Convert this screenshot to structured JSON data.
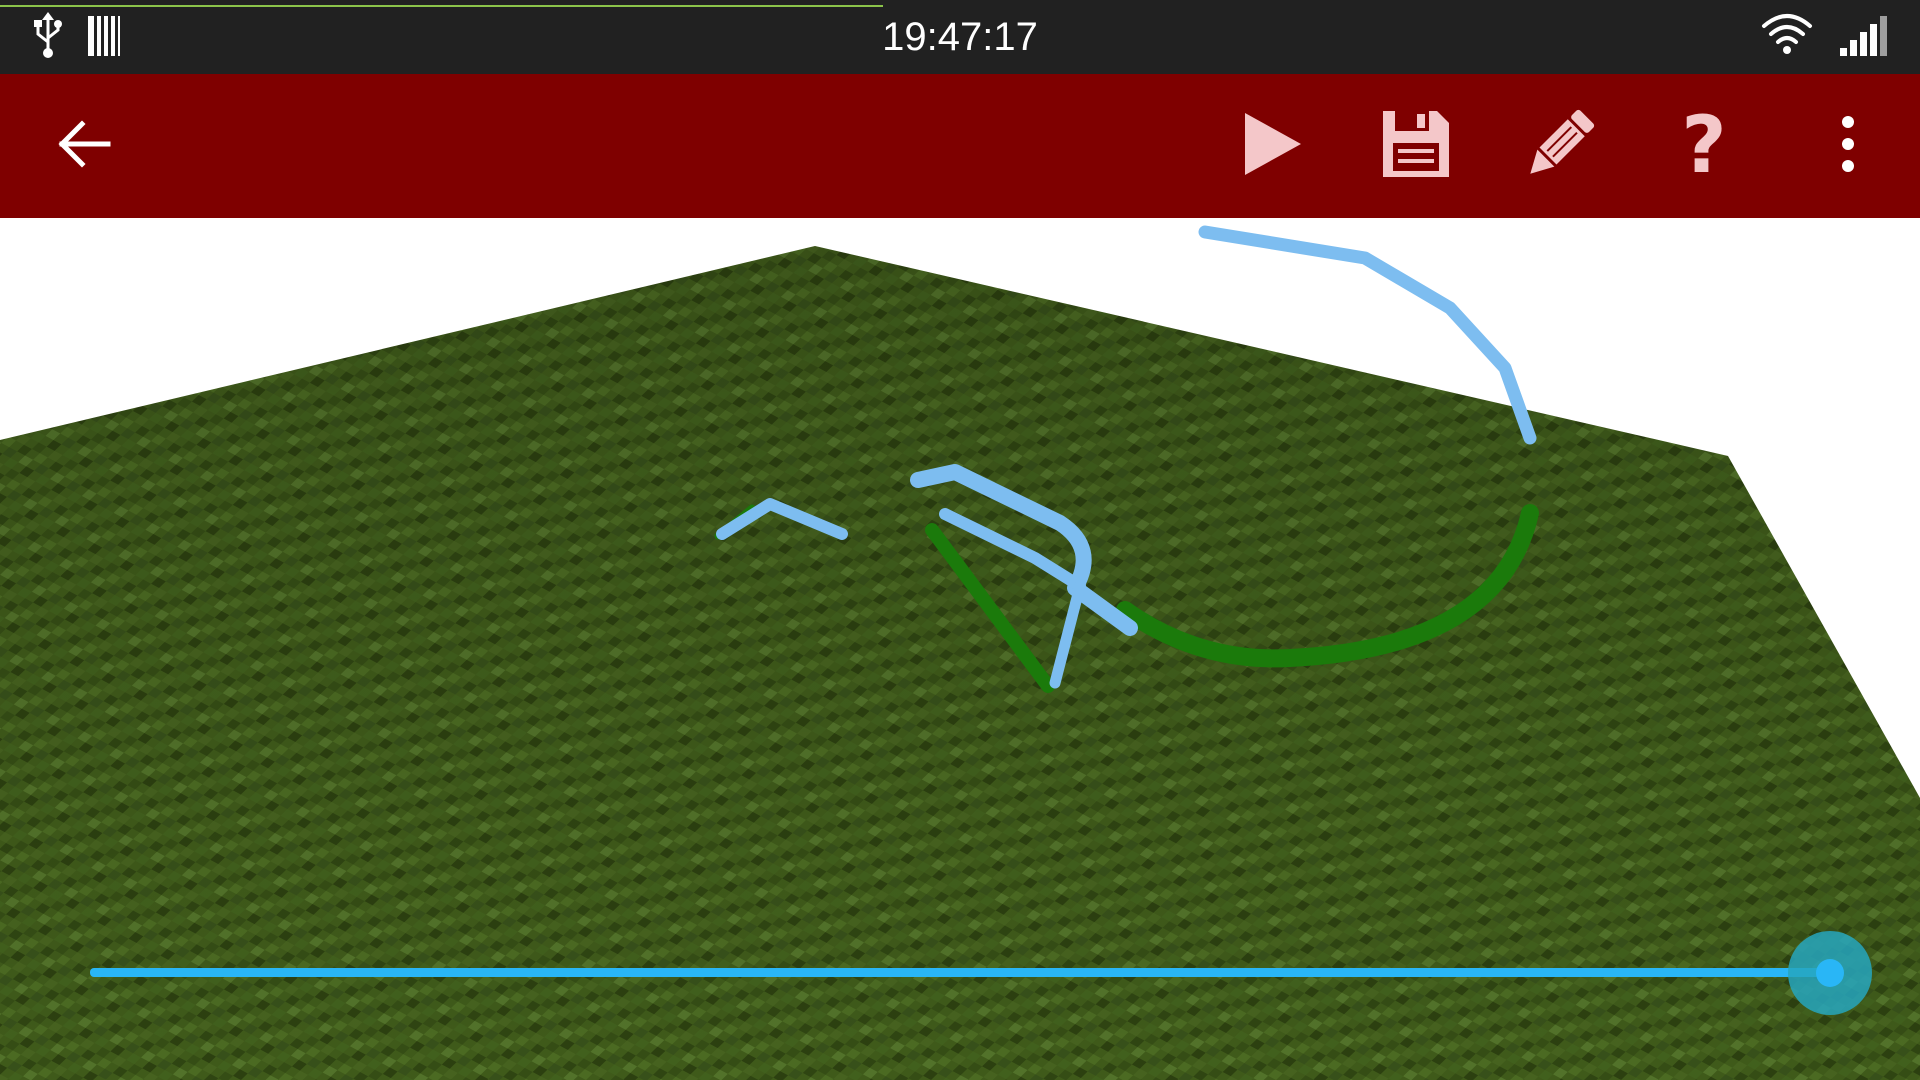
{
  "status_bar": {
    "time": "19:47:17",
    "icons": [
      "usb-icon",
      "storage-icon",
      "wifi-icon",
      "signal-icon"
    ]
  },
  "toolbar": {
    "icons": [
      "back-arrow-icon",
      "play-icon",
      "save-icon",
      "pencil-icon",
      "help-icon",
      "more-vert-icon"
    ],
    "help_glyph": "?"
  },
  "colors": {
    "status_bar": "#212121",
    "app_bar": "#7f0000",
    "toolbar_icon": "#ffffff",
    "toolbar_action_icon": "#f4c7c9",
    "ground": "#3f5a1a",
    "path_above_ground": "#7dbdf0",
    "path_below_ground": "#1b7a0b",
    "slider": "#29b6f6",
    "slider_halo": "#26a6be"
  },
  "timeline": {
    "progress": 1.0
  }
}
